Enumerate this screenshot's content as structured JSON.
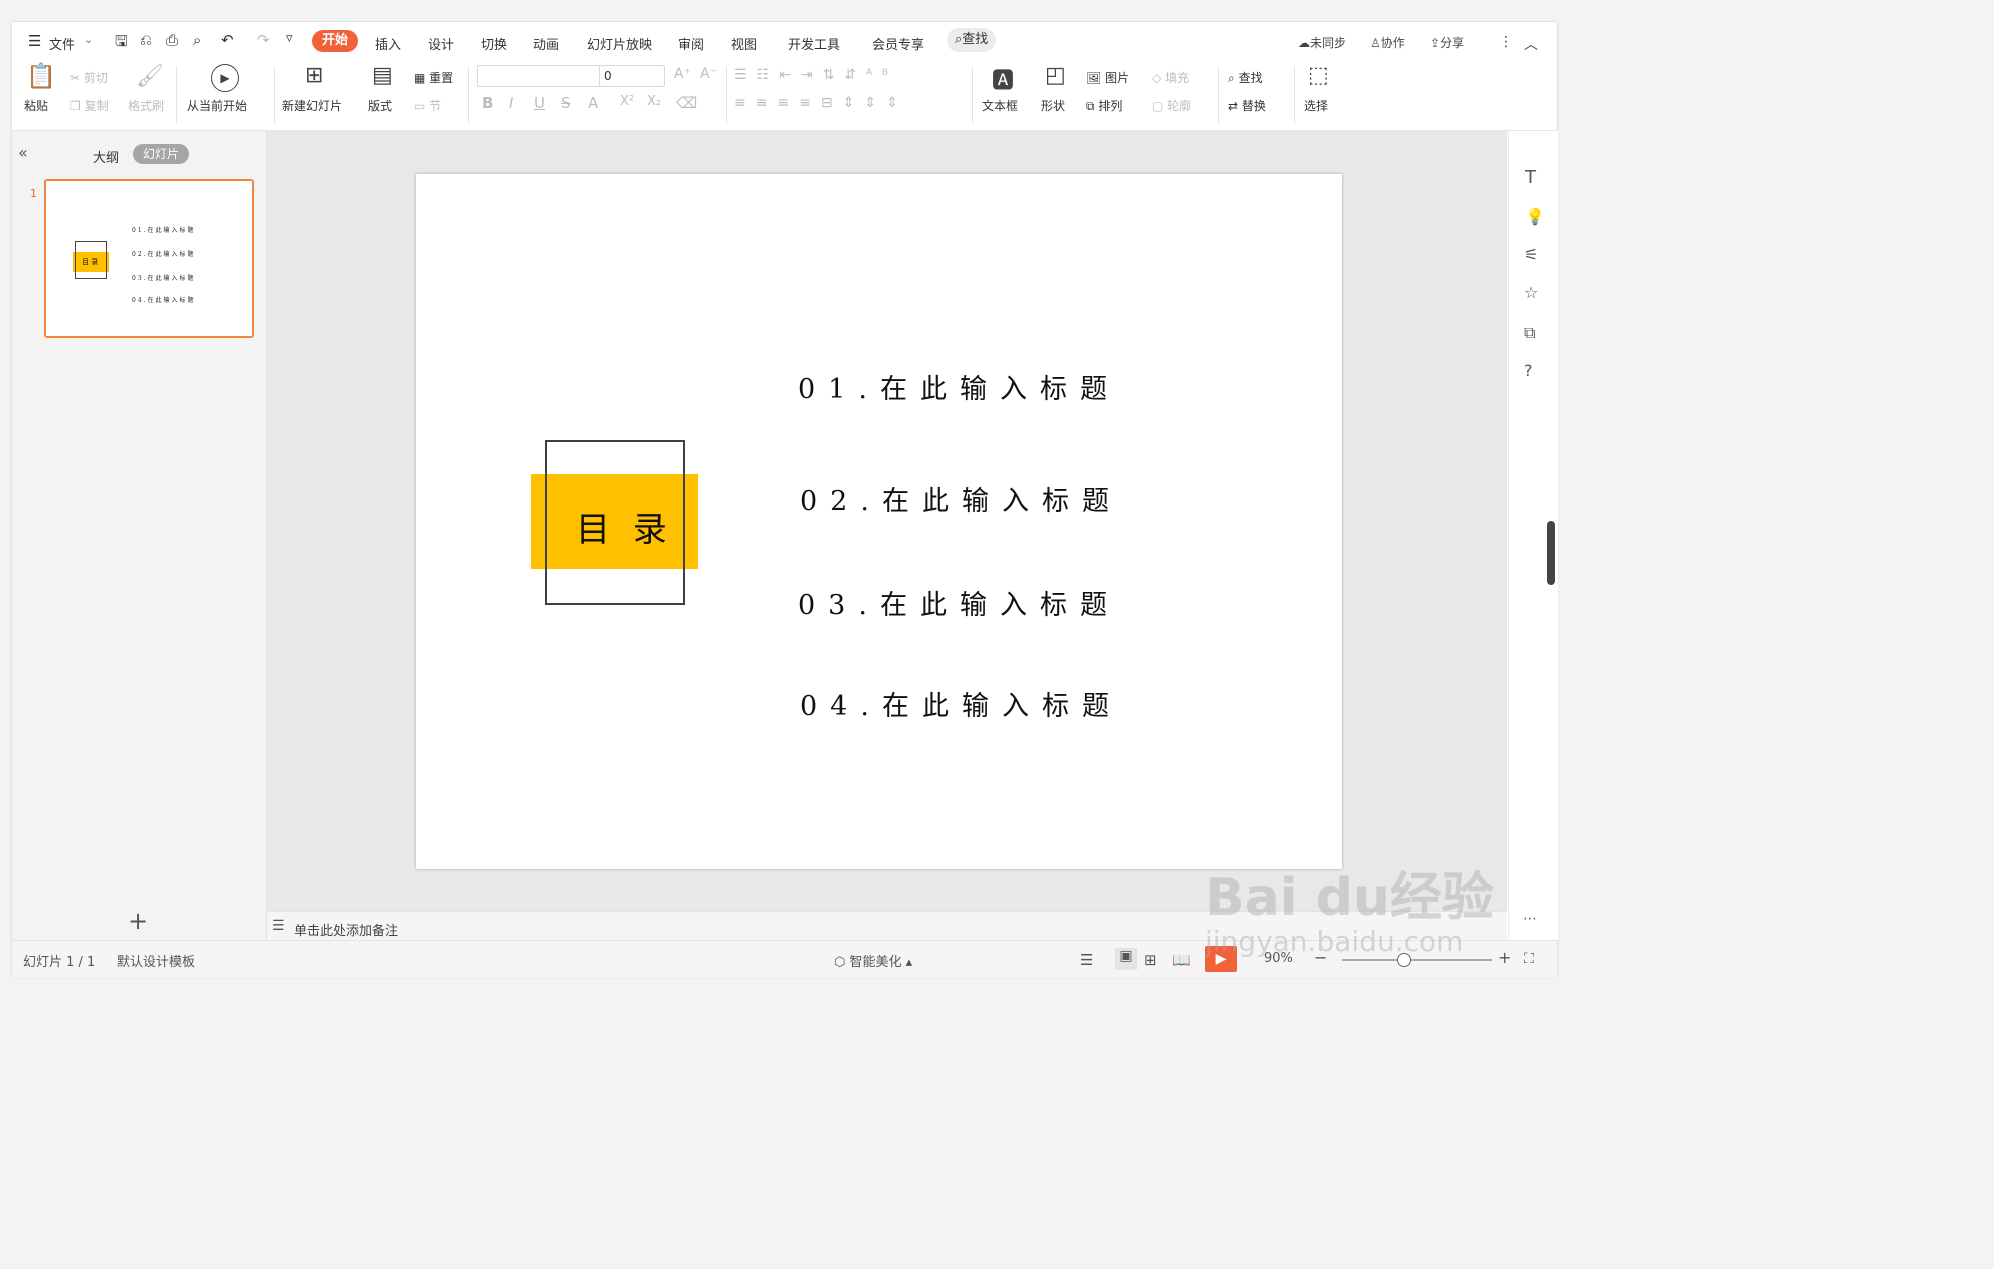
{
  "menu": {
    "file_label": "文件"
  },
  "tabs": [
    "开始",
    "插入",
    "设计",
    "切换",
    "动画",
    "幻灯片放映",
    "审阅",
    "视图",
    "开发工具",
    "会员专享"
  ],
  "search_label": "查找",
  "top_right": {
    "sync": "未同步",
    "collab": "协作",
    "share": "分享"
  },
  "ribbon": {
    "paste": "粘贴",
    "cut": "剪切",
    "copy": "复制",
    "format_painter": "格式刷",
    "from_current": "从当前开始",
    "new_slide": "新建幻灯片",
    "layout": "版式",
    "reset": "重置",
    "section": "节",
    "font_size": "0",
    "textbox": "文本框",
    "shape": "形状",
    "picture": "图片",
    "arrange": "排列",
    "fill": "填充",
    "outline": "轮廓",
    "find": "查找",
    "replace": "替换",
    "select": "选择"
  },
  "left_panel": {
    "tab_outline": "大纲",
    "tab_slides": "幻灯片",
    "slide_number": "1"
  },
  "slide": {
    "title_label": "目 录",
    "items": [
      "01.在此输入标题",
      "02.在此输入标题",
      "03.在此输入标题",
      "04.在此输入标题"
    ],
    "accent_color": "#FFC000"
  },
  "notes_placeholder": "单击此处添加备注",
  "status": {
    "slide_info": "幻灯片 1 / 1",
    "template": "默认设计模板",
    "beautify": "智能美化",
    "zoom": "90%"
  },
  "watermark": {
    "brand": "Bai du经验",
    "url": "jingyan.baidu.com"
  }
}
